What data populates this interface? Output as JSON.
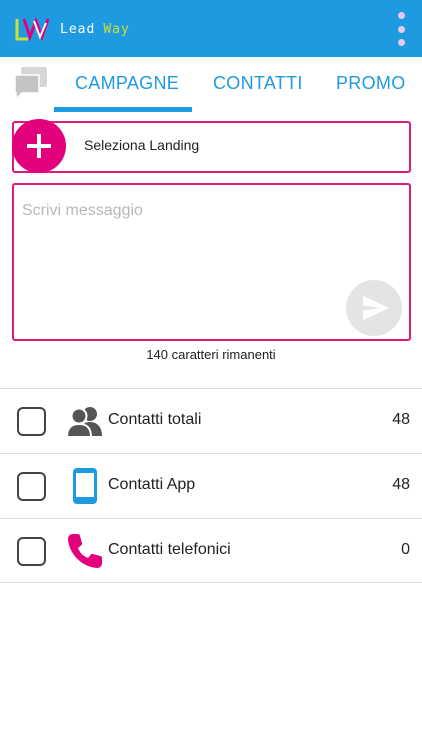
{
  "app": {
    "logo_word1": "Lead",
    "logo_word2": "Way",
    "logo_icon": "leadway-logo-icon",
    "menu_icon": "overflow-menu-icon"
  },
  "tabs": {
    "chat_icon": "chat-icon",
    "items": [
      {
        "label": "CAMPAGNE",
        "selected": true
      },
      {
        "label": "CONTATTI",
        "selected": false
      },
      {
        "label": "PROMO",
        "selected": false
      }
    ]
  },
  "landing": {
    "label": "Seleziona Landing",
    "icon": "plus-icon"
  },
  "message": {
    "placeholder": "Scrivi messaggio",
    "value": "",
    "send_icon": "send-icon",
    "remaining": "140 caratteri rimanenti"
  },
  "contacts": [
    {
      "label": "Contatti totali",
      "count": "48",
      "icon": "people-icon",
      "checked": false
    },
    {
      "label": "Contatti App",
      "count": "48",
      "icon": "smartphone-icon",
      "checked": false
    },
    {
      "label": "Contatti telefonici",
      "count": "0",
      "icon": "phone-icon",
      "checked": false
    }
  ],
  "colors": {
    "primary": "#1e9be0",
    "accent": "#e3007d",
    "logo_green": "#c8e03a",
    "people_icon": "#555555",
    "smartphone_icon": "#1e9be0",
    "phone_icon": "#e3007d"
  }
}
